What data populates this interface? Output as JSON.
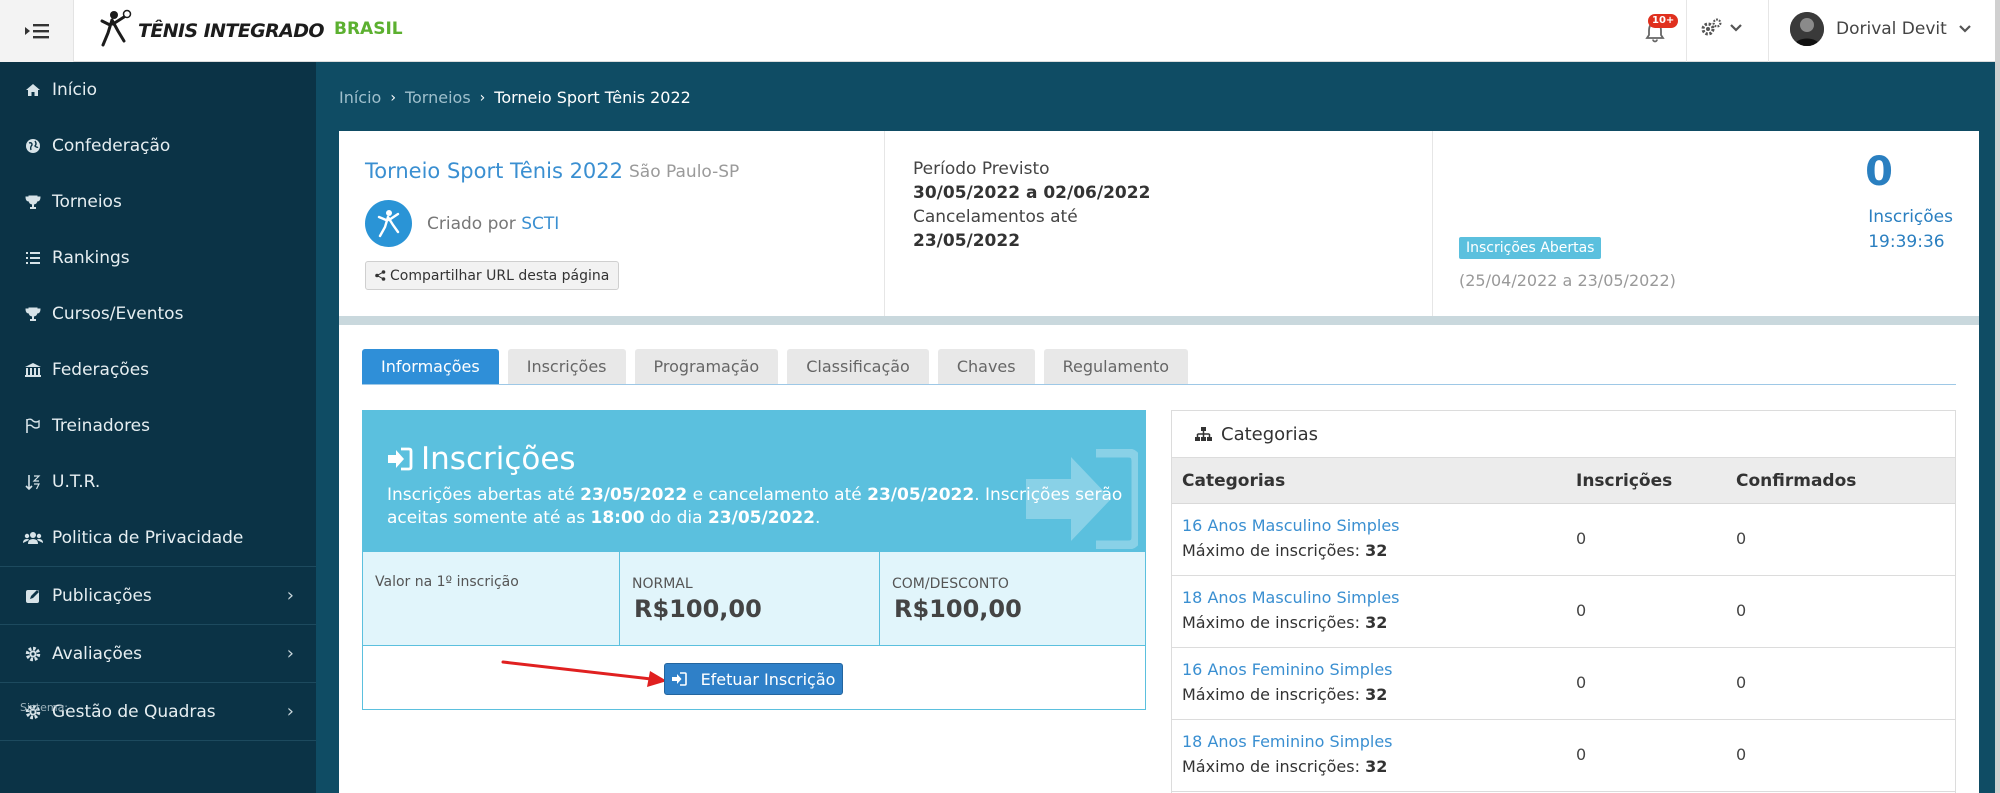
{
  "header": {
    "brand": "TÊNIS INTEGRADO",
    "country": "BRASIL",
    "notifications_badge": "10+",
    "user_name": "Dorival Devit"
  },
  "sidebar": {
    "items": [
      {
        "label": "Início",
        "icon": "home-icon"
      },
      {
        "label": "Confederação",
        "icon": "globe-icon"
      },
      {
        "label": "Torneios",
        "icon": "trophy-icon"
      },
      {
        "label": "Rankings",
        "icon": "list-icon"
      },
      {
        "label": "Cursos/Eventos",
        "icon": "trophy-icon"
      },
      {
        "label": "Federações",
        "icon": "bank-icon"
      },
      {
        "label": "Treinadores",
        "icon": "flag-icon"
      },
      {
        "label": "U.T.R.",
        "icon": "sort-icon"
      },
      {
        "label": "Politica de Privacidade",
        "icon": "users-icon"
      }
    ],
    "groups": [
      {
        "label": "Publicações",
        "icon": "edit-icon"
      },
      {
        "label": "Avaliações",
        "icon": "gear-icon"
      },
      {
        "label": "Gestão de Quadras",
        "icon": "gear-icon"
      }
    ],
    "system_label": "Sistema:"
  },
  "breadcrumb": {
    "home": "Início",
    "section": "Torneios",
    "current": "Torneio Sport Tênis 2022"
  },
  "tournament": {
    "title": "Torneio Sport Tênis 2022",
    "city": "São Paulo-SP",
    "created_by_label": "Criado por",
    "created_by": "SCTI",
    "share_label": "Compartilhar URL desta página",
    "period_label": "Período Previsto",
    "period_value": "30/05/2022 a 02/06/2022",
    "cancel_label": "Cancelamentos até",
    "cancel_value": "23/05/2022",
    "status_badge": "Inscrições Abertas",
    "status_range": "(25/04/2022 a 23/05/2022)",
    "count": "0",
    "count_label": "Inscrições",
    "count_time": "19:39:36"
  },
  "tabs": [
    "Informações",
    "Inscrições",
    "Programação",
    "Classificação",
    "Chaves",
    "Regulamento"
  ],
  "inscricoes": {
    "title": "Inscrições",
    "text_1": "Inscrições abertas até ",
    "date_1": "23/05/2022",
    "text_2": " e cancelamento até ",
    "date_2": "23/05/2022",
    "text_3": ". Inscrições serão aceitas somente até as ",
    "time": "18:00",
    "text_4": " do dia ",
    "date_3": "23/05/2022",
    "text_5": ".",
    "first_label": "Valor na 1º inscrição",
    "normal_label": "NORMAL",
    "normal_value": "R$100,00",
    "discount_label": "COM/DESCONTO",
    "discount_value": "R$100,00",
    "button_label": "Efetuar Inscrição"
  },
  "categorias": {
    "title": "Categorias",
    "columns": [
      "Categorias",
      "Inscrições",
      "Confirmados"
    ],
    "max_label": "Máximo de inscrições: ",
    "rows": [
      {
        "name": "16 Anos Masculino Simples",
        "max": "32",
        "inscricoes": "0",
        "confirmados": "0"
      },
      {
        "name": "18 Anos Masculino Simples",
        "max": "32",
        "inscricoes": "0",
        "confirmados": "0"
      },
      {
        "name": "16 Anos Feminino Simples",
        "max": "32",
        "inscricoes": "0",
        "confirmados": "0"
      },
      {
        "name": "18 Anos Feminino Simples",
        "max": "32",
        "inscricoes": "0",
        "confirmados": "0"
      }
    ]
  },
  "colors": {
    "sidebar_bg": "#0b3346",
    "main_bg": "#0f4c64",
    "accent_blue": "#2f8fd8",
    "info_cyan": "#5bc0de",
    "brand_green": "#5cb030",
    "arrow_red": "#e02020"
  }
}
